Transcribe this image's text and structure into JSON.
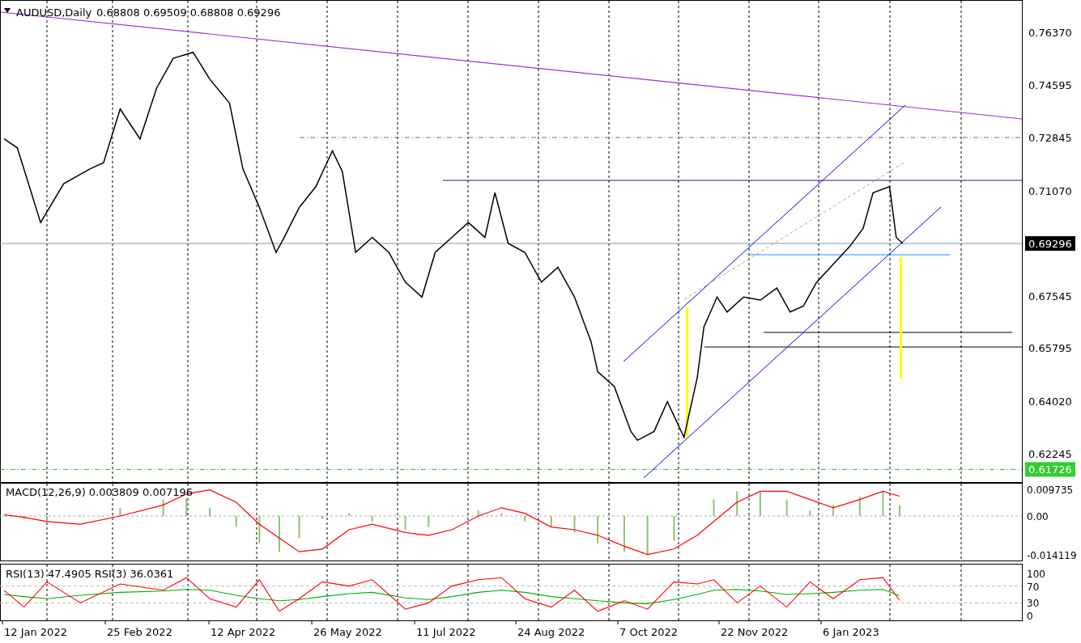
{
  "header": {
    "symbol": "AUDUSD,Daily",
    "ohlc": "0.68808 0.69509 0.68808 0.69296"
  },
  "price_chart": {
    "current_price": "0.69296",
    "marked_price": "0.61726",
    "axis_labels": [
      "0.76370",
      "0.74595",
      "0.72845",
      "0.71070",
      "0.67545",
      "0.65795",
      "0.64020",
      "0.62245"
    ]
  },
  "macd": {
    "label": "MACD(12,26,9) 0.003809 0.007196",
    "axis_labels": [
      "0.009735",
      "0.00",
      "-0.014119"
    ]
  },
  "rsi": {
    "label": "RSI(13) 47.4905  RSI(3) 36.0361",
    "axis_labels": [
      "100",
      "70",
      "30",
      "0"
    ]
  },
  "date_labels": [
    "12 Jan 2022",
    "25 Feb 2022",
    "12 Apr 2022",
    "26 May 2022",
    "11 Jul 2022",
    "24 Aug 2022",
    "7 Oct 2022",
    "22 Nov 2022",
    "6 Jan 2023"
  ]
}
